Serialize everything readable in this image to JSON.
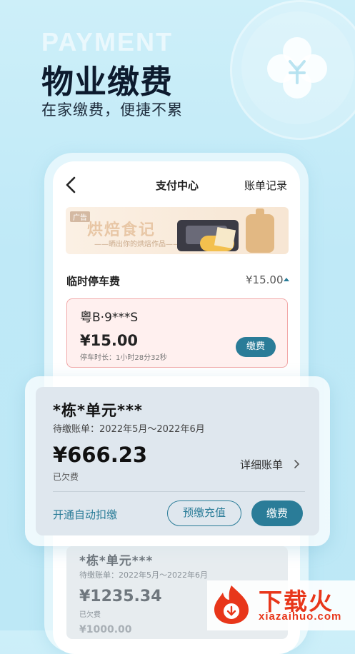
{
  "hero": {
    "watermark": "PAYMENT",
    "title": "物业缴费",
    "subtitle": "在家缴费，便捷不累"
  },
  "nav": {
    "title": "支付中心",
    "right_link": "账单记录"
  },
  "ad": {
    "tag": "广告",
    "title": "烘焙食记",
    "subtitle": "——晒出你的烘焙作品——"
  },
  "parking": {
    "label": "临时停车费",
    "total": "¥15.00",
    "plate": "粤B·9***S",
    "amount": "¥15.00",
    "duration": "停车时长：1小时28分32秒",
    "pay_button": "缴费"
  },
  "property_bill": {
    "title": "*栋*单元***",
    "period": "待缴账单：2022年5月～2022年6月",
    "amount": "¥666.23",
    "status": "已欠费",
    "detail_link": "详细账单",
    "auto_deduct": "开通自动扣缴",
    "prepay_button": "预缴充值",
    "pay_button": "缴费"
  },
  "property_bill_2": {
    "title": "*栋*单元***",
    "period": "待缴账单：2022年5月～2022年6月",
    "amount": "¥1235.34",
    "status": "已欠费",
    "next_amount": "¥1000.00"
  },
  "brand": {
    "name": "下载火",
    "url": "xiazaihuo.com"
  },
  "colors": {
    "accent": "#2a7c98",
    "background": "#c5ecf8",
    "brand": "#e8361a"
  }
}
